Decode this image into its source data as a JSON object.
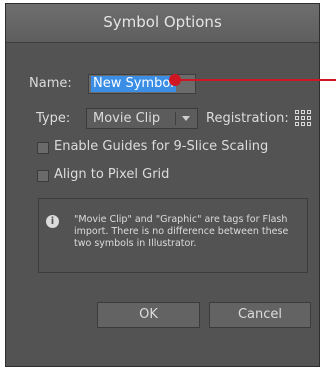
{
  "dialog": {
    "title": "Symbol Options",
    "name_label": "Name:",
    "name_value": "New Symbol",
    "type_label": "Type:",
    "type_value": "Movie Clip",
    "registration_label": "Registration:",
    "checkbox_guides": {
      "label": "Enable Guides for 9-Slice Scaling",
      "checked": false
    },
    "checkbox_pixel": {
      "label": "Align to Pixel Grid",
      "checked": false
    },
    "info_text": "\"Movie Clip\" and \"Graphic\" are tags for Flash import. There is no difference between these two symbols in Illustrator.",
    "ok_label": "OK",
    "cancel_label": "Cancel"
  },
  "colors": {
    "dialog_bg": "#535353",
    "selection": "#3a8ee6",
    "callout": "#d01623"
  }
}
